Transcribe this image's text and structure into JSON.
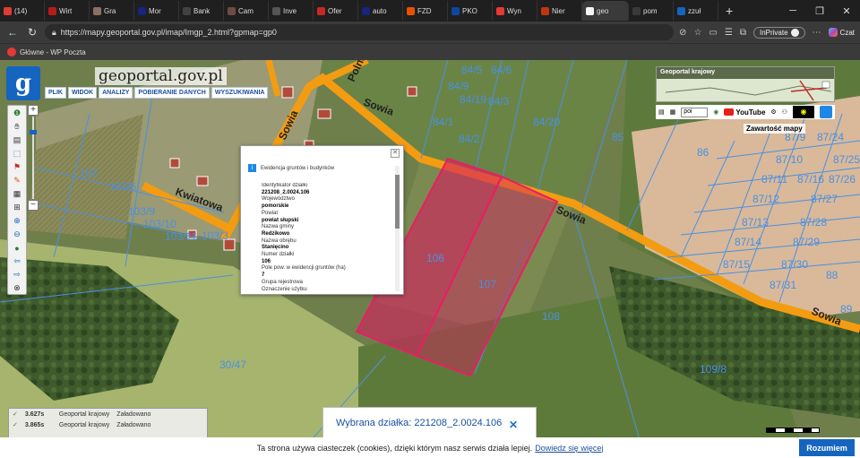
{
  "browser": {
    "tabs": [
      {
        "label": "(14)",
        "color": "#e53935"
      },
      {
        "label": "Wirt",
        "color": "#b71c1c"
      },
      {
        "label": "Gra",
        "color": "#8d6e63"
      },
      {
        "label": "Mor",
        "color": "#1a237e"
      },
      {
        "label": "Bank",
        "color": "#424242"
      },
      {
        "label": "Cam",
        "color": "#6d4c41"
      },
      {
        "label": "Inve",
        "color": "#555555"
      },
      {
        "label": "Ofer",
        "color": "#c62828"
      },
      {
        "label": "auto",
        "color": "#1a237e"
      },
      {
        "label": "FZD",
        "color": "#e65100"
      },
      {
        "label": "PKO",
        "color": "#0d47a1"
      },
      {
        "label": "Wyn",
        "color": "#e53935"
      },
      {
        "label": "Nier",
        "color": "#bf360c"
      },
      {
        "label": "geo",
        "color": "#f5f5f5",
        "active": true
      },
      {
        "label": "pom",
        "color": "#3a3a3a"
      },
      {
        "label": "zzuł",
        "color": "#1565c0"
      }
    ],
    "new_tab": "+",
    "url": "https://mapy.geoportal.gov.pl/imap/Imgp_2.html?gpmap=gp0",
    "inprivate": "InPrivate",
    "copilot": "Czat",
    "bookmark": "Główne - WP Poczta"
  },
  "portal": {
    "brand": "geoportal.gov.pl",
    "logo_letter": "g",
    "menu": [
      "PLIK",
      "WIDOK",
      "ANALIZY",
      "POBIERANIE DANYCH",
      "WYSZUKIWANIA"
    ],
    "overview_title": "Geoportal krajowy",
    "select_value": "poi",
    "youtube": "YouTube",
    "content_label": "Zawartość mapy"
  },
  "popup": {
    "title": "Ewidencja gruntów i budynków",
    "fields": [
      {
        "label": "Identyfikator działki",
        "value": "221208_2.0024.106"
      },
      {
        "label": "Województwo",
        "value": "pomorskie"
      },
      {
        "label": "Powiat",
        "value": "powiat słupski"
      },
      {
        "label": "Nazwa gminy",
        "value": "Redzikowo"
      },
      {
        "label": "Nazwa obrębu",
        "value": "Stanięcino"
      },
      {
        "label": "Numer działki",
        "value": "106"
      },
      {
        "label": "Pole pow. w ewidencji gruntów (ha)",
        "value": "7"
      },
      {
        "label": "Grupa rejestrowa",
        "value": ""
      },
      {
        "label": "Oznaczenie użytku",
        "value": ""
      },
      {
        "label": "Oznaczenie konturu",
        "value": ""
      }
    ]
  },
  "map_labels": {
    "streets": [
      "Sowia",
      "Sowia",
      "Sowia",
      "Kwiatowa",
      "Polna",
      "Sowia"
    ],
    "parcels": [
      "84/5",
      "84/6",
      "84/9",
      "84/3",
      "84/19",
      "84/20",
      "84/2",
      "85",
      "86",
      "84/1",
      "102",
      "103/6",
      "103/9",
      "103/10",
      "103/11",
      "103/3",
      "87/9",
      "87/24",
      "87/10",
      "87/25",
      "87/11",
      "87/16",
      "87/26",
      "87/12",
      "87/27",
      "87/13",
      "87/28",
      "87/14",
      "87/29",
      "87/15",
      "87/30",
      "87/31",
      "88",
      "89",
      "30/47",
      "109/8",
      "106",
      "107",
      "108"
    ]
  },
  "status": [
    {
      "time": "3.627s",
      "layer": "Geoportal krajowy",
      "state": "Załadowano"
    },
    {
      "time": "3.865s",
      "layer": "Geoportal krajowy",
      "state": "Załadowano"
    }
  ],
  "selection": {
    "label": "Wybrana działka: 221208_2.0024.106",
    "close": "✕"
  },
  "cookie": {
    "text": "Ta strona używa ciasteczek (cookies), dzięki którym nasz serwis działa lepiej.",
    "link": "Dowiedz się więcej",
    "button": "Rozumiem"
  },
  "colors": {
    "parcel_line": "#4a90e2",
    "road": "#f39c12",
    "selected_fill": "#d81b60",
    "accent": "#1565c0"
  }
}
